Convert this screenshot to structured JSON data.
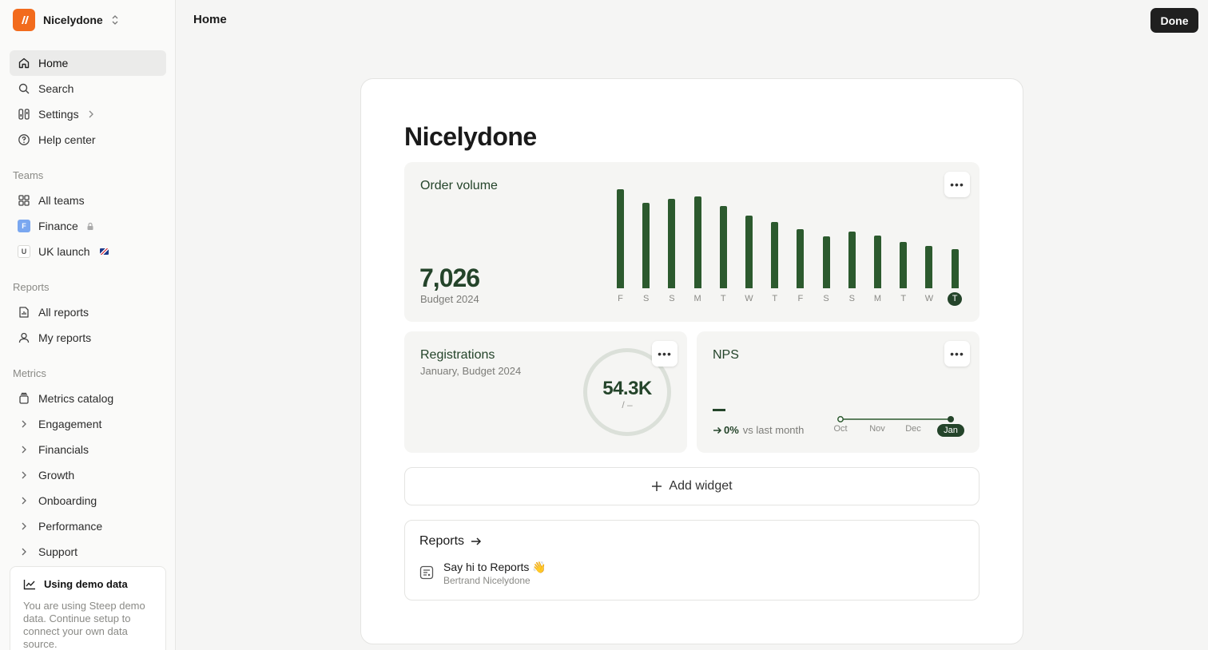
{
  "workspace": {
    "name": "Nicelydone"
  },
  "nav": [
    {
      "label": "Home",
      "icon": "home-icon",
      "active": true
    },
    {
      "label": "Search",
      "icon": "search-icon"
    },
    {
      "label": "Settings",
      "icon": "settings-icon"
    },
    {
      "label": "Help center",
      "icon": "help-icon"
    }
  ],
  "teams": {
    "label": "Teams",
    "items": [
      {
        "label": "All teams",
        "icon": "grid-icon"
      },
      {
        "label": "Finance",
        "badge": "F"
      },
      {
        "label": "UK launch",
        "badge": "U"
      }
    ]
  },
  "reports_section": {
    "label": "Reports",
    "items": [
      {
        "label": "All reports",
        "icon": "report-icon"
      },
      {
        "label": "My reports",
        "icon": "user-icon"
      }
    ]
  },
  "metrics": {
    "label": "Metrics",
    "items": [
      {
        "label": "Metrics catalog",
        "icon": "catalog-icon"
      },
      {
        "label": "Engagement"
      },
      {
        "label": "Financials"
      },
      {
        "label": "Growth"
      },
      {
        "label": "Onboarding"
      },
      {
        "label": "Performance"
      },
      {
        "label": "Support"
      }
    ]
  },
  "demo": {
    "title": "Using demo data",
    "text": "You are using Steep demo data. Continue setup to connect your own data source."
  },
  "topbar": {
    "title": "Home",
    "done_label": "Done"
  },
  "page": {
    "title": "Nicelydone"
  },
  "order_volume": {
    "title": "Order volume",
    "value": "7,026",
    "sub": "Budget 2024"
  },
  "registrations": {
    "title": "Registrations",
    "sub": "January, Budget 2024",
    "value": "54.3K",
    "target": "/ –"
  },
  "nps": {
    "title": "NPS",
    "value": "–",
    "delta": "0%",
    "delta_text": "vs last month",
    "months": [
      "Oct",
      "Nov",
      "Dec",
      "Jan"
    ]
  },
  "add_widget_label": "Add widget",
  "reports_card": {
    "title": "Reports",
    "item_name": "Say hi to Reports",
    "item_author": "Bertrand Nicelydone"
  },
  "colors": {
    "accent": "#24442a",
    "bar": "#2c5a2e",
    "logo": "#f26b1d"
  },
  "chart_data": {
    "type": "bar",
    "title": "Order volume",
    "categories": [
      "F",
      "S",
      "S",
      "M",
      "T",
      "W",
      "T",
      "F",
      "S",
      "S",
      "M",
      "T",
      "W",
      "T"
    ],
    "values": [
      124,
      107,
      112,
      115,
      103,
      91,
      83,
      74,
      65,
      71,
      66,
      58,
      53,
      49
    ],
    "highlight_index": 13,
    "ylim": [
      0,
      124
    ],
    "grid": false
  }
}
